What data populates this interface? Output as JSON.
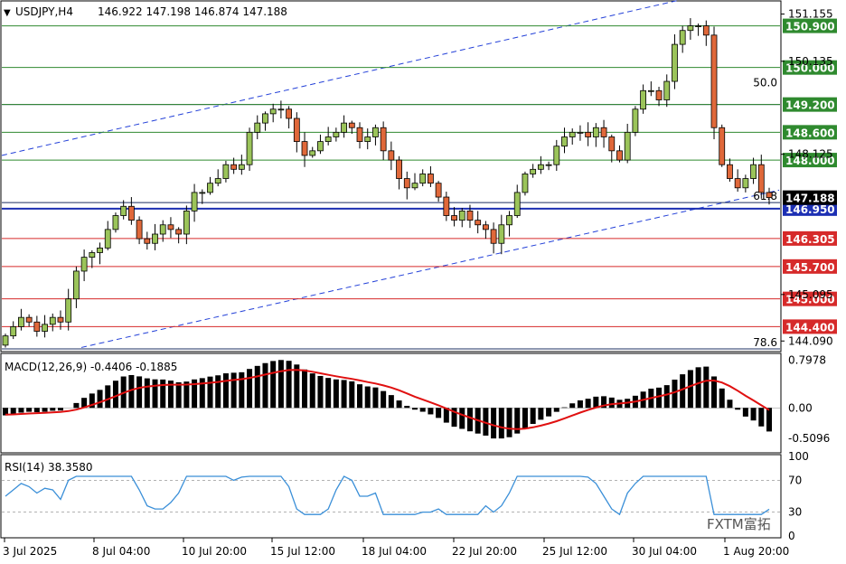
{
  "header": {
    "symbol": "USDJPY,H4",
    "ohlc": "146.922 147.198 146.874 147.188"
  },
  "colors": {
    "bull": "#9bc45a",
    "bear": "#e0683a",
    "resistance_line": "#2f8a2f",
    "support_line": "#d62a2a",
    "current_line": "#1c2fb3",
    "channel": "#2340d8",
    "macd_signal": "#e01010",
    "rsi": "#3a8fd8"
  },
  "price_axis": {
    "ticks": [
      "151.155",
      "150.135",
      "148.125",
      "145.095",
      "144.090"
    ],
    "range": [
      143.9,
      151.4
    ]
  },
  "fib_labels": [
    {
      "text": "50.0",
      "price": 149.53
    },
    {
      "text": "61.8",
      "price": 147.08
    },
    {
      "text": "78.6",
      "price": 143.92
    }
  ],
  "resistance_levels": [
    {
      "label": "150.900",
      "price": 150.9
    },
    {
      "label": "150.000",
      "price": 150.0
    },
    {
      "label": "149.200",
      "price": 149.2
    },
    {
      "label": "148.600",
      "price": 148.6
    },
    {
      "label": "148.000",
      "price": 148.0
    }
  ],
  "current_price": {
    "label": "147.188",
    "price": 147.188
  },
  "pivot_level": {
    "label": "146.950",
    "price": 146.95
  },
  "support_levels": [
    {
      "label": "146.305",
      "price": 146.305
    },
    {
      "label": "145.700",
      "price": 145.7
    },
    {
      "label": "145.000",
      "price": 145.0
    },
    {
      "label": "144.400",
      "price": 144.4
    }
  ],
  "macd": {
    "title": "MACD(12,26,9) -0.4406 -0.1885",
    "ticks": [
      "0.7978",
      "0.00",
      "-0.5096"
    ],
    "range": [
      -0.72,
      0.88
    ]
  },
  "rsi": {
    "title": "RSI(14) 38.3580",
    "ticks": [
      "100",
      "70",
      "30",
      "0"
    ],
    "levels": [
      70,
      30
    ]
  },
  "time_axis": [
    "3 Jul 2025",
    "8 Jul 04:00",
    "10 Jul 20:00",
    "15 Jul 12:00",
    "18 Jul 04:00",
    "22 Jul 20:00",
    "25 Jul 12:00",
    "30 Jul 04:00",
    "1 Aug 20:00"
  ],
  "watermark": "FXTM富拓",
  "chart_data": {
    "type": "candlestick",
    "title": "USDJPY,H4",
    "x_labels": [
      "3 Jul 2025",
      "8 Jul 04:00",
      "10 Jul 20:00",
      "15 Jul 12:00",
      "18 Jul 04:00",
      "22 Jul 20:00",
      "25 Jul 12:00",
      "30 Jul 04:00",
      "1 Aug 20:00"
    ],
    "ylim": [
      143.9,
      151.4
    ],
    "close_path": [
      144.2,
      144.4,
      144.6,
      144.5,
      144.3,
      144.45,
      144.6,
      144.5,
      145.0,
      145.6,
      145.9,
      146.0,
      146.1,
      146.5,
      146.8,
      147.0,
      146.7,
      146.3,
      146.2,
      146.4,
      146.6,
      146.5,
      146.4,
      146.9,
      147.3,
      147.3,
      147.5,
      147.6,
      147.9,
      147.8,
      147.9,
      148.6,
      148.8,
      149.0,
      149.1,
      149.1,
      148.9,
      148.4,
      148.1,
      148.2,
      148.4,
      148.5,
      148.6,
      148.8,
      148.7,
      148.4,
      148.5,
      148.7,
      148.2,
      148.0,
      147.6,
      147.4,
      147.5,
      147.7,
      147.5,
      147.2,
      146.8,
      146.7,
      146.9,
      146.7,
      146.6,
      146.5,
      146.2,
      146.6,
      146.8,
      147.3,
      147.7,
      147.8,
      147.9,
      147.9,
      148.3,
      148.5,
      148.6,
      148.6,
      148.5,
      148.7,
      148.5,
      148.2,
      148.0,
      148.6,
      149.1,
      149.5,
      149.5,
      149.3,
      149.7,
      150.5,
      150.8,
      150.9,
      150.9,
      150.7,
      148.7,
      147.9,
      147.6,
      147.4,
      147.6,
      147.9,
      147.3,
      147.19
    ],
    "macd": {
      "histogram_range": [
        -0.51,
        0.8
      ],
      "signal_range": [
        -0.47,
        0.72
      ]
    },
    "rsi_range": [
      27,
      75
    ]
  }
}
